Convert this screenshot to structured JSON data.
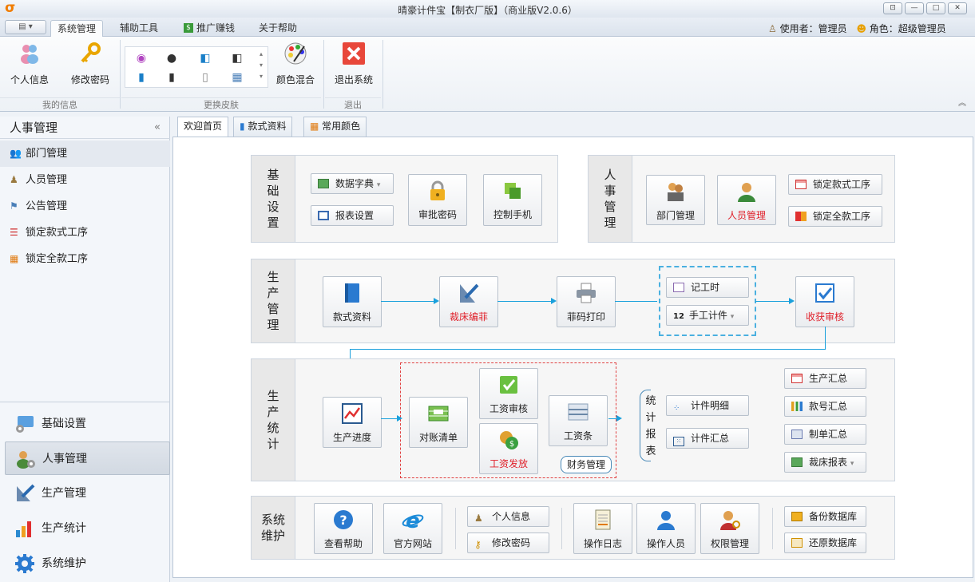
{
  "window": {
    "title": "晴豪计件宝【制衣厂版】（商业版V2.0.6）"
  },
  "menu": {
    "tabs": [
      "系统管理",
      "辅助工具",
      "推广赚钱",
      "关于帮助"
    ],
    "active": 0
  },
  "user": {
    "user_label": "使用者：管理员",
    "role_label": "角色：超级管理员"
  },
  "ribbon": {
    "group1": {
      "label": "我的信息",
      "buttons": [
        "个人信息",
        "修改密码"
      ]
    },
    "group2": {
      "label": "更换皮肤",
      "color_button": "颜色混合"
    },
    "group3": {
      "label": "退出",
      "buttons": [
        "退出系统"
      ]
    }
  },
  "sidebar": {
    "title": "人事管理",
    "items": [
      {
        "label": "部门管理",
        "icon": "department-icon"
      },
      {
        "label": "人员管理",
        "icon": "person-icon"
      },
      {
        "label": "公告管理",
        "icon": "announce-icon"
      },
      {
        "label": "锁定款式工序",
        "icon": "lock-style-icon"
      },
      {
        "label": "锁定全款工序",
        "icon": "lock-all-icon"
      }
    ],
    "nav": [
      {
        "label": "基础设置",
        "icon": "settings-icon"
      },
      {
        "label": "人事管理",
        "icon": "hr-icon"
      },
      {
        "label": "生产管理",
        "icon": "production-icon"
      },
      {
        "label": "生产统计",
        "icon": "stats-icon"
      },
      {
        "label": "系统维护",
        "icon": "gear-icon"
      }
    ],
    "nav_active": 1
  },
  "tabs": [
    "欢迎首页",
    "款式资料",
    "常用颜色"
  ],
  "panels": {
    "basic": {
      "label": "基础设置",
      "buttons": {
        "dict": "数据字典",
        "report": "报表设置",
        "approve": "审批密码",
        "phone": "控制手机"
      }
    },
    "hr": {
      "label": "人事管理",
      "buttons": {
        "dept": "部门管理",
        "staff": "人员管理",
        "lock_style": "锁定款式工序",
        "lock_all": "锁定全款工序"
      }
    },
    "prod": {
      "label": "生产管理",
      "buttons": {
        "style": "款式资料",
        "cut": "裁床编菲",
        "print": "菲码打印",
        "record": "记工时",
        "manual": "手工计件",
        "check": "收获审核"
      },
      "manual_prefix": "12"
    },
    "stats": {
      "label": "生产统计",
      "buttons": {
        "progress": "生产进度",
        "reconcile": "对账清单",
        "wage_check": "工资审核",
        "wage_pay": "工资发放",
        "payslip": "工资条"
      },
      "finance_note": "财务管理",
      "report_label": "统计报表",
      "reports": {
        "detail": "计件明细",
        "summary": "计件汇总"
      },
      "summaries": [
        "生产汇总",
        "款号汇总",
        "制单汇总",
        "裁床报表"
      ]
    },
    "maint": {
      "label": "系统维护",
      "buttons": {
        "help": "查看帮助",
        "site": "官方网站",
        "profile": "个人信息",
        "pwd": "修改密码",
        "log": "操作日志",
        "operator": "操作人员",
        "perm": "权限管理",
        "backup": "备份数据库",
        "restore": "还原数据库"
      }
    }
  },
  "colors": {
    "accent": "#1aa0dc",
    "red": "#e0202a",
    "brand": "#f07c00"
  }
}
